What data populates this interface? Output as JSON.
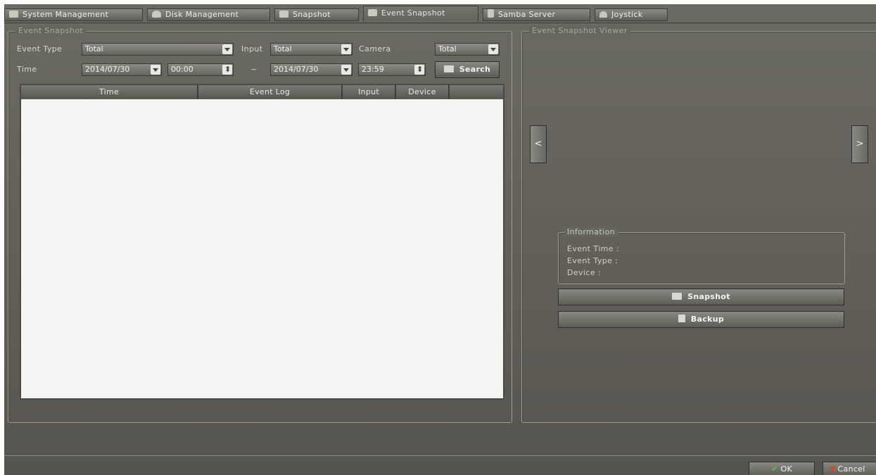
{
  "tabs": [
    {
      "label": "System Management",
      "icon": "system-icon"
    },
    {
      "label": "Disk Management",
      "icon": "disk-icon"
    },
    {
      "label": "Snapshot",
      "icon": "snapshot-icon"
    },
    {
      "label": "Event Snapshot",
      "icon": "event-snapshot-icon",
      "active": true
    },
    {
      "label": "Samba Server",
      "icon": "samba-icon"
    },
    {
      "label": "Joystick",
      "icon": "joystick-icon"
    }
  ],
  "event_snapshot": {
    "legend": "Event Snapshot",
    "event_type_label": "Event Type",
    "event_type_value": "Total",
    "input_label": "Input",
    "input_value": "Total",
    "camera_label": "Camera",
    "camera_value": "Total",
    "time_label": "Time",
    "start_date": "2014/07/30",
    "start_time": "00:00",
    "range_separator": "~",
    "end_date": "2014/07/30",
    "end_time": "23:59",
    "search_label": "Search",
    "columns": [
      "Time",
      "Event Log",
      "Input",
      "Device"
    ]
  },
  "viewer": {
    "legend": "Event Snapshot Viewer",
    "prev_label": "<",
    "next_label": ">",
    "info_legend": "Information",
    "event_time_label": "Event Time :",
    "event_type_label": "Event Type :",
    "device_label": "Device :",
    "snapshot_label": "Snapshot",
    "backup_label": "Backup"
  },
  "footer": {
    "ok_label": "OK",
    "cancel_label": "Cancel"
  },
  "colors": {
    "ok": "#5fbf3a",
    "cancel": "#d8402a"
  }
}
